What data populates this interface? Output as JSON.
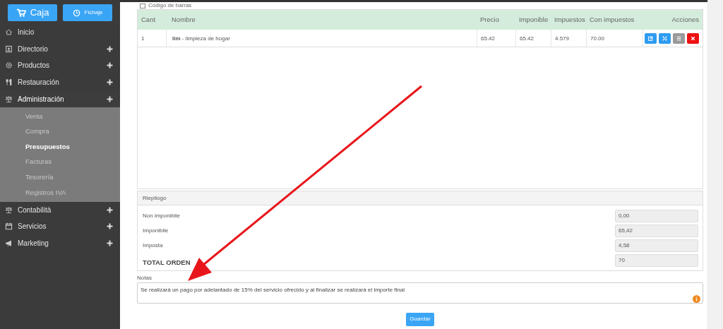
{
  "sidebar": {
    "buttons": [
      {
        "label": "Caja",
        "kind": "cart"
      },
      {
        "label": "Fichaje",
        "kind": "clock"
      }
    ],
    "items": [
      {
        "label": "Inicio",
        "expandable": false,
        "expanded": false
      },
      {
        "label": "Directorio",
        "expandable": true,
        "expanded": false
      },
      {
        "label": "Productos",
        "expandable": true,
        "expanded": false
      },
      {
        "label": "Restauración",
        "expandable": true,
        "expanded": false
      },
      {
        "label": "Administración",
        "expandable": true,
        "expanded": true,
        "children": [
          {
            "label": "Venta",
            "selected": false
          },
          {
            "label": "Compra",
            "selected": false
          },
          {
            "label": "Presupuestos",
            "selected": true
          },
          {
            "label": "Facturas",
            "selected": false
          },
          {
            "label": "Tesorería",
            "selected": false
          },
          {
            "label": "Registros IVA",
            "selected": false
          }
        ]
      },
      {
        "label": "Contabilità",
        "expandable": true,
        "expanded": false
      },
      {
        "label": "Servicios",
        "expandable": true,
        "expanded": false
      },
      {
        "label": "Marketing",
        "expandable": true,
        "expanded": false
      }
    ]
  },
  "barcode": {
    "label": "Código de barras",
    "checked": false
  },
  "table": {
    "columns": [
      "Cant",
      "Nombre",
      "Precio",
      "Imponible",
      "Impuestos",
      "Con impuestos",
      "Acciones"
    ],
    "rows": [
      {
        "cells": [
          "1",
          "**lim** - limpieza de hogar",
          "65.42",
          "65.42",
          "4.579",
          "70.00"
        ],
        "actions": [
          {
            "kind": "edit",
            "color": "#2e9cf0"
          },
          {
            "kind": "percent",
            "color": "#2e9cf0"
          },
          {
            "kind": "list",
            "color": "#9a9a9a"
          },
          {
            "kind": "delete",
            "color": "#ee1111"
          }
        ]
      }
    ]
  },
  "summary": {
    "title": "Riepilogo",
    "rows": [
      {
        "label": "Non imponibile",
        "value": "0,00",
        "kind": "normal"
      },
      {
        "label": "Imponibile",
        "value": "65,42",
        "kind": "normal"
      },
      {
        "label": "Imposta",
        "value": "4,58",
        "kind": "normal"
      },
      {
        "label": "TOTAL ORDEN",
        "value": "70",
        "kind": "total"
      }
    ]
  },
  "notes": {
    "label": "Notas",
    "value": "Se realizará un pago por adelantado de 15% del servicio ofrecido y al finalizar se realizará el importe final"
  },
  "save_button": "Guardar"
}
